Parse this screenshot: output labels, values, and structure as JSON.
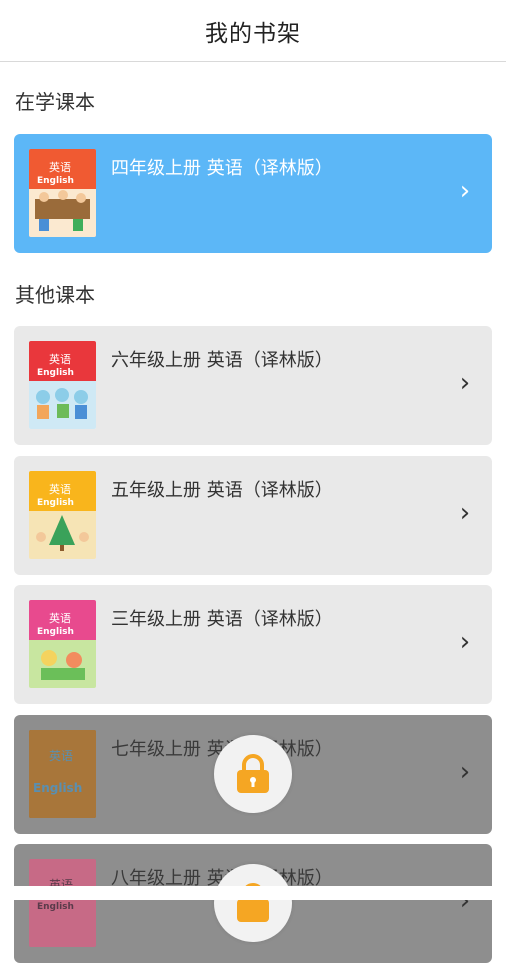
{
  "header": {
    "title": "我的书架"
  },
  "current_section": {
    "title": "在学课本",
    "book": {
      "title": "四年级上册 英语（译林版）",
      "cover_label": "英语",
      "cover_label_en": "English"
    }
  },
  "other_section": {
    "title": "其他课本",
    "books": [
      {
        "title": "六年级上册 英语（译林版）",
        "cover_label": "英语",
        "cover_label_en": "English",
        "locked": false
      },
      {
        "title": "五年级上册 英语（译林版）",
        "cover_label": "英语",
        "cover_label_en": "English",
        "locked": false
      },
      {
        "title": "三年级上册 英语（译林版）",
        "cover_label": "英语",
        "cover_label_en": "English",
        "locked": false
      },
      {
        "title": "七年级上册 英语（译林版）",
        "cover_label": "英语",
        "cover_label_en": "English",
        "locked": true
      },
      {
        "title": "八年级上册 英语（译林版）",
        "cover_label": "英语",
        "cover_label_en": "English",
        "locked": true
      }
    ]
  },
  "colors": {
    "accent": "#5cb7f7",
    "card": "#e9e9e9",
    "locked_overlay": "#8e8e8e",
    "lock_icon": "#f5a623"
  },
  "icons": {
    "chevron": "chevron-right-icon",
    "lock": "lock-icon"
  }
}
